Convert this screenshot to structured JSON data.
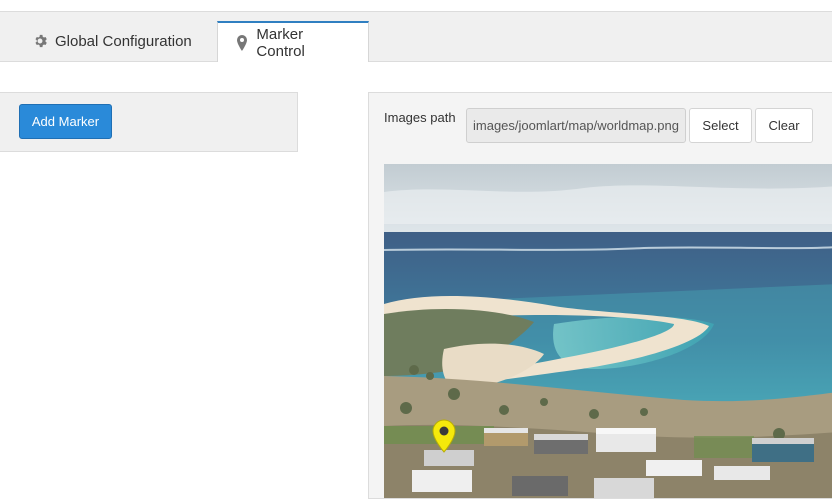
{
  "tabs": [
    {
      "label": "Global Configuration",
      "icon": "gear-icon",
      "active": false
    },
    {
      "label": "Marker Control",
      "icon": "map-pin-icon",
      "active": true
    }
  ],
  "left": {
    "add_marker_label": "Add Marker"
  },
  "right": {
    "images_path_label": "Images path",
    "images_path_value": "images/joomlart/map/worldmap.png",
    "select_label": "Select",
    "clear_label": "Clear"
  },
  "marker": {
    "icon": "map-pin-icon",
    "color": "#f5e90b"
  },
  "colors": {
    "accent": "#2a8ad9",
    "tab_border": "#2f7fc1"
  }
}
